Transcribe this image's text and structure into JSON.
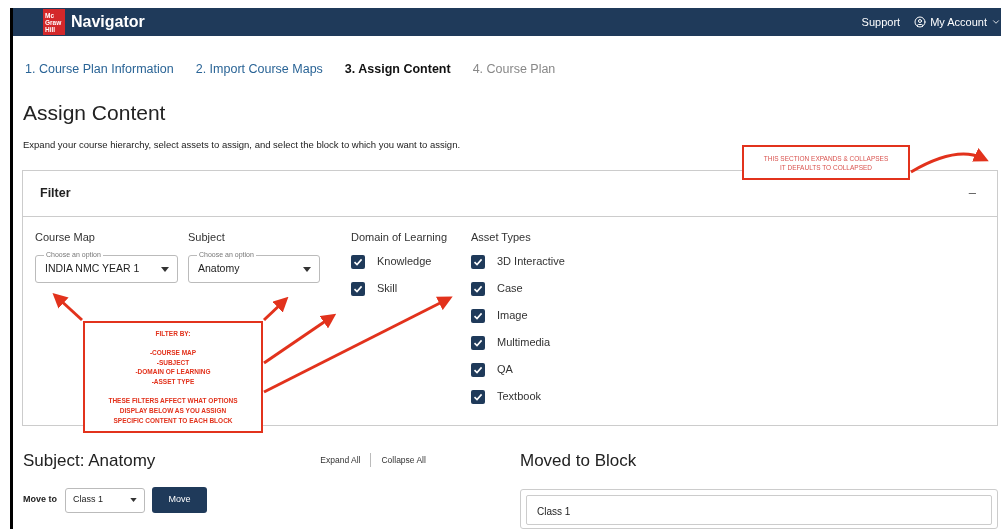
{
  "header": {
    "logo_lines": [
      "Mc",
      "Graw",
      "Hill"
    ],
    "app_name": "Navigator",
    "links": [
      {
        "label": "Support",
        "kind": "text"
      },
      {
        "label": "My Account",
        "kind": "account"
      }
    ]
  },
  "steps": [
    {
      "label": "1. Course Plan Information",
      "selected": false,
      "disabled": false
    },
    {
      "label": "2. Import Course Maps",
      "selected": false,
      "disabled": false
    },
    {
      "label": "3. Assign Content",
      "selected": true,
      "disabled": false
    },
    {
      "label": "4. Course Plan",
      "selected": false,
      "disabled": true
    }
  ],
  "page_title": "Assign Content",
  "description": "Expand your course hierarchy, select assets to assign, and select the block to which you want to assign.",
  "filter": {
    "title": "Filter",
    "expanded": true,
    "toggle": "–",
    "dropdowns": [
      {
        "label": "Course Map",
        "floating_label": "Choose an option",
        "value": "INDIA NMC YEAR 1"
      },
      {
        "label": "Subject",
        "floating_label": "Choose an option",
        "value": "Anatomy"
      }
    ],
    "groups": [
      {
        "label": "Domain of Learning",
        "options": [
          {
            "label": "Knowledge",
            "checked": true
          },
          {
            "label": "Skill",
            "checked": true
          }
        ]
      },
      {
        "label": "Asset Types",
        "options": [
          {
            "label": "3D Interactive",
            "checked": true
          },
          {
            "label": "Case",
            "checked": true
          },
          {
            "label": "Image",
            "checked": true
          },
          {
            "label": "Multimedia",
            "checked": true
          },
          {
            "label": "QA",
            "checked": true
          },
          {
            "label": "Textbook",
            "checked": true
          }
        ]
      }
    ]
  },
  "annotations": [
    {
      "paragraphs": [
        [
          "THIS SECTION EXPANDS & COLLAPSES",
          "IT DEFAULTS TO COLLAPSED"
        ]
      ]
    },
    {
      "paragraphs": [
        [
          "FILTER BY:"
        ],
        [
          "-COURSE MAP",
          "-SUBJECT",
          "-DOMAIN OF LEARNING",
          "-ASSET TYPE"
        ],
        [
          "THESE FILTERS AFFECT WHAT OPTIONS",
          "DISPLAY BELOW AS YOU ASSIGN",
          "SPECIFIC CONTENT TO EACH BLOCK"
        ]
      ]
    }
  ],
  "subject_panel": {
    "title": "Subject: Anatomy",
    "expand_all": "Expand All",
    "collapse_all": "Collapse All",
    "move_label": "Move to",
    "move_select": "Class 1",
    "move_button": "Move"
  },
  "moved_panel": {
    "title": "Moved to Block",
    "first_block": "Class 1"
  }
}
